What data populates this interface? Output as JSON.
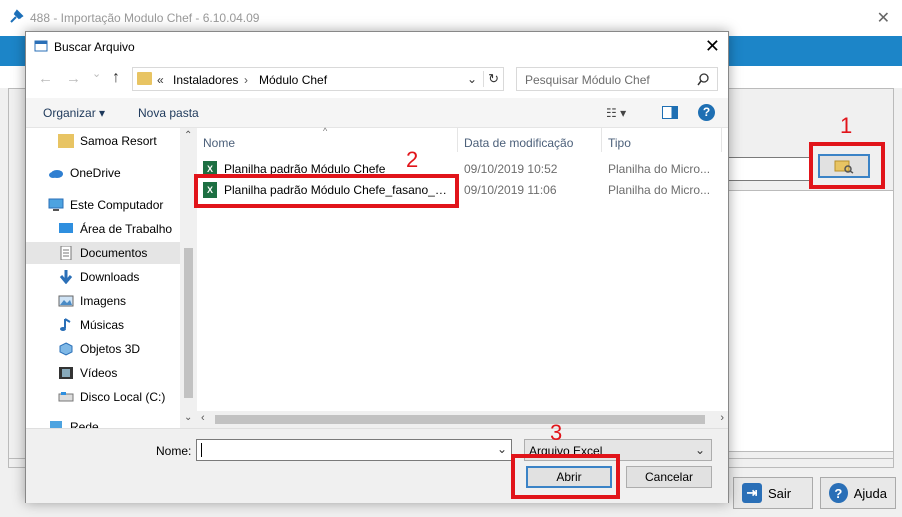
{
  "app": {
    "title": "488 - Importação Modulo Chef - 6.10.04.09",
    "close_symbol": "✕",
    "exit_label": "Sair",
    "help_label": "Ajuda"
  },
  "dialog": {
    "title": "Buscar Arquivo",
    "close_symbol": "✕",
    "nav": {
      "back": "←",
      "forward": "→",
      "recent": "⌄",
      "up": "↑",
      "breadcrumb_prefix": "«",
      "path": [
        "Instaladores",
        "Módulo Chef"
      ],
      "path_separator": "›",
      "dropdown": "⌄",
      "refresh": "↻"
    },
    "search_placeholder": "Pesquisar Módulo Chef",
    "toolbar": {
      "organize": "Organizar ▾",
      "new_folder": "Nova pasta",
      "view": "☷ ▾",
      "help": "?"
    },
    "nav_items": [
      {
        "label": "Samoa Resort",
        "icon": "folder-icon"
      },
      {
        "label": "OneDrive",
        "icon": "cloud-icon"
      },
      {
        "label": "Este Computador",
        "icon": "computer-icon"
      },
      {
        "label": "Área de Trabalho",
        "icon": "desktop-icon"
      },
      {
        "label": "Documentos",
        "icon": "documents-icon"
      },
      {
        "label": "Downloads",
        "icon": "download-icon"
      },
      {
        "label": "Imagens",
        "icon": "pictures-icon"
      },
      {
        "label": "Músicas",
        "icon": "music-icon"
      },
      {
        "label": "Objetos 3D",
        "icon": "objects3d-icon"
      },
      {
        "label": "Vídeos",
        "icon": "video-icon"
      },
      {
        "label": "Disco Local (C:)",
        "icon": "drive-icon"
      },
      {
        "label": "Rede",
        "icon": "network-icon"
      }
    ],
    "nav_scroll": {
      "up": "⌃",
      "down": "⌄"
    },
    "files_scroll": {
      "left": "‹",
      "right": "›"
    },
    "columns": [
      "Nome",
      "Data de modificação",
      "Tipo"
    ],
    "sort_indicator": "^",
    "excel_badge": "X",
    "files": [
      {
        "name": "Planilha padrão Módulo Chefe",
        "date": "09/10/2019 10:52",
        "type": "Planilha do Micro..."
      },
      {
        "name": "Planilha padrão Módulo Chefe_fasano_b...",
        "date": "09/10/2019 11:06",
        "type": "Planilha do Micro..."
      }
    ],
    "filename_label": "Nome:",
    "filename_value": "",
    "filename_dropdown": "⌄",
    "filetype": "Arquivo Excel",
    "filetype_dropdown": "⌄",
    "open_button": "Abrir",
    "cancel_button": "Cancelar"
  },
  "annotations": [
    "1",
    "2",
    "3"
  ],
  "colors": {
    "annotation": "#e1141a",
    "banner": "#1c85c8",
    "accent": "#3b83c6"
  }
}
